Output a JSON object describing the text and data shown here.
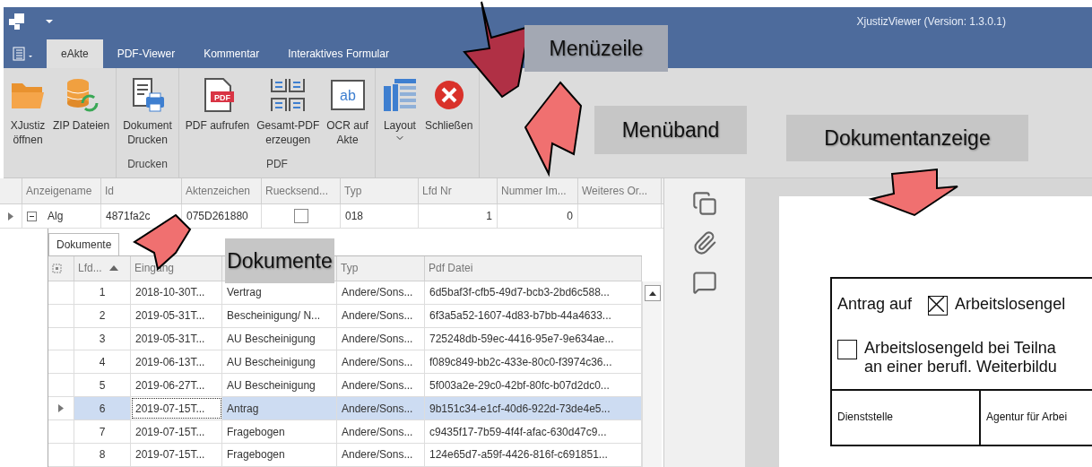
{
  "window": {
    "title": "XjustizViewer (Version: 1.3.0.1)"
  },
  "ribbon_tabs": [
    {
      "label": "eAkte",
      "selected": true
    },
    {
      "label": "PDF-Viewer",
      "selected": false
    },
    {
      "label": "Kommentar",
      "selected": false
    },
    {
      "label": "Interaktives Formular",
      "selected": false
    }
  ],
  "ribbon_groups": [
    {
      "buttons": [
        {
          "kind": "folder",
          "label": "XJustiz\nöffnen",
          "dropdown": false
        },
        {
          "kind": "database",
          "label": "ZIP Dateien",
          "dropdown": false
        }
      ]
    },
    {
      "label": "Drucken",
      "buttons": [
        {
          "kind": "printer",
          "label": "Dokument\nDrucken",
          "dropdown": false
        }
      ]
    },
    {
      "label": "PDF",
      "buttons": [
        {
          "kind": "pdf",
          "label": "PDF aufrufen",
          "icon_text": "PDF",
          "dropdown": false
        },
        {
          "kind": "merge",
          "label": "Gesamt-PDF\nerzeugen",
          "dropdown": false
        },
        {
          "kind": "ocr",
          "label": "OCR auf\nAkte",
          "icon_text": "ab",
          "dropdown": false
        }
      ]
    },
    {
      "buttons": [
        {
          "kind": "layout",
          "label": "Layout",
          "dropdown": true
        },
        {
          "kind": "close",
          "label": "Schließen",
          "dropdown": false
        }
      ]
    }
  ],
  "main_grid": {
    "columns": [
      "Anzeigename",
      "Id",
      "Aktenzeichen",
      "Ruecksend...",
      "Typ",
      "Lfd Nr",
      "Nummer Im...",
      "Weiteres Or..."
    ],
    "rows": [
      {
        "current": true,
        "expanded": true,
        "name": "Alg",
        "id": "4871fa2c",
        "aktenzeichen": "075D261880",
        "ruecksendung": false,
        "typ": "018",
        "lfd_nr": "1",
        "nummer": "0"
      }
    ]
  },
  "detail_tabs": [
    {
      "label": "Dokumente",
      "selected": true
    }
  ],
  "documents": {
    "columns": [
      {
        "label": "Lfd...",
        "sorted": true
      },
      {
        "label": "Eingang",
        "sorted": false
      },
      {},
      {
        "label": "Typ",
        "sorted": false
      },
      {
        "label": "Pdf Datei",
        "sorted": false
      }
    ],
    "rows": [
      {
        "selected": false,
        "lfd": "1",
        "eingang": "2018-10-30T...",
        "name": "Vertrag",
        "typ": "Andere/Sons...",
        "pdf": "6d5baf3f-cfb5-49d7-bcb3-2bd6c588..."
      },
      {
        "selected": false,
        "lfd": "2",
        "eingang": "2019-05-31T...",
        "name": "Bescheinigung/ N...",
        "typ": "Andere/Sons...",
        "pdf": "6f3a5a52-1607-4d83-b7bb-44a4633..."
      },
      {
        "selected": false,
        "lfd": "3",
        "eingang": "2019-05-31T...",
        "name": "AU Bescheinigung",
        "typ": "Andere/Sons...",
        "pdf": "725248db-59ec-4416-95e7-9e634ae..."
      },
      {
        "selected": false,
        "lfd": "4",
        "eingang": "2019-06-13T...",
        "name": "AU Bescheinigung",
        "typ": "Andere/Sons...",
        "pdf": "f089c849-bb2c-433e-80c0-f3974c36..."
      },
      {
        "selected": false,
        "lfd": "5",
        "eingang": "2019-06-27T...",
        "name": "AU Bescheinigung",
        "typ": "Andere/Sons...",
        "pdf": "5f003a2e-29c0-42bf-80fc-b07d2dc0..."
      },
      {
        "selected": true,
        "lfd": "6",
        "eingang": "2019-07-15T...",
        "name": "Antrag",
        "typ": "Andere/Sons...",
        "pdf": "9b151c34-e1cf-40d6-922d-73de4e5..."
      },
      {
        "selected": false,
        "lfd": "7",
        "eingang": "2019-07-15T...",
        "name": "Fragebogen",
        "typ": "Andere/Sons...",
        "pdf": "c9435f17-7b59-4f4f-afac-630d47c9..."
      },
      {
        "selected": false,
        "lfd": "8",
        "eingang": "2019-07-15T...",
        "name": "Fragebogen",
        "typ": "Andere/Sons...",
        "pdf": "124e65d7-a59f-4426-816f-c691851..."
      }
    ]
  },
  "viewer": {
    "page": {
      "heading": "Antrag auf",
      "options": [
        {
          "label": "Arbeitslosengel",
          "checked": true
        },
        {
          "label": "Arbeitslosengeld bei Teilna\nan einer berufl. Weiterbildu",
          "checked": false
        }
      ],
      "fields": [
        "Dienststelle",
        "Agentur für Arbei"
      ]
    }
  },
  "annotations": [
    {
      "label": "Menüzeile"
    },
    {
      "label": "Menüband"
    },
    {
      "label": "Dokumentanzeige"
    },
    {
      "label": "Dokumente"
    }
  ]
}
